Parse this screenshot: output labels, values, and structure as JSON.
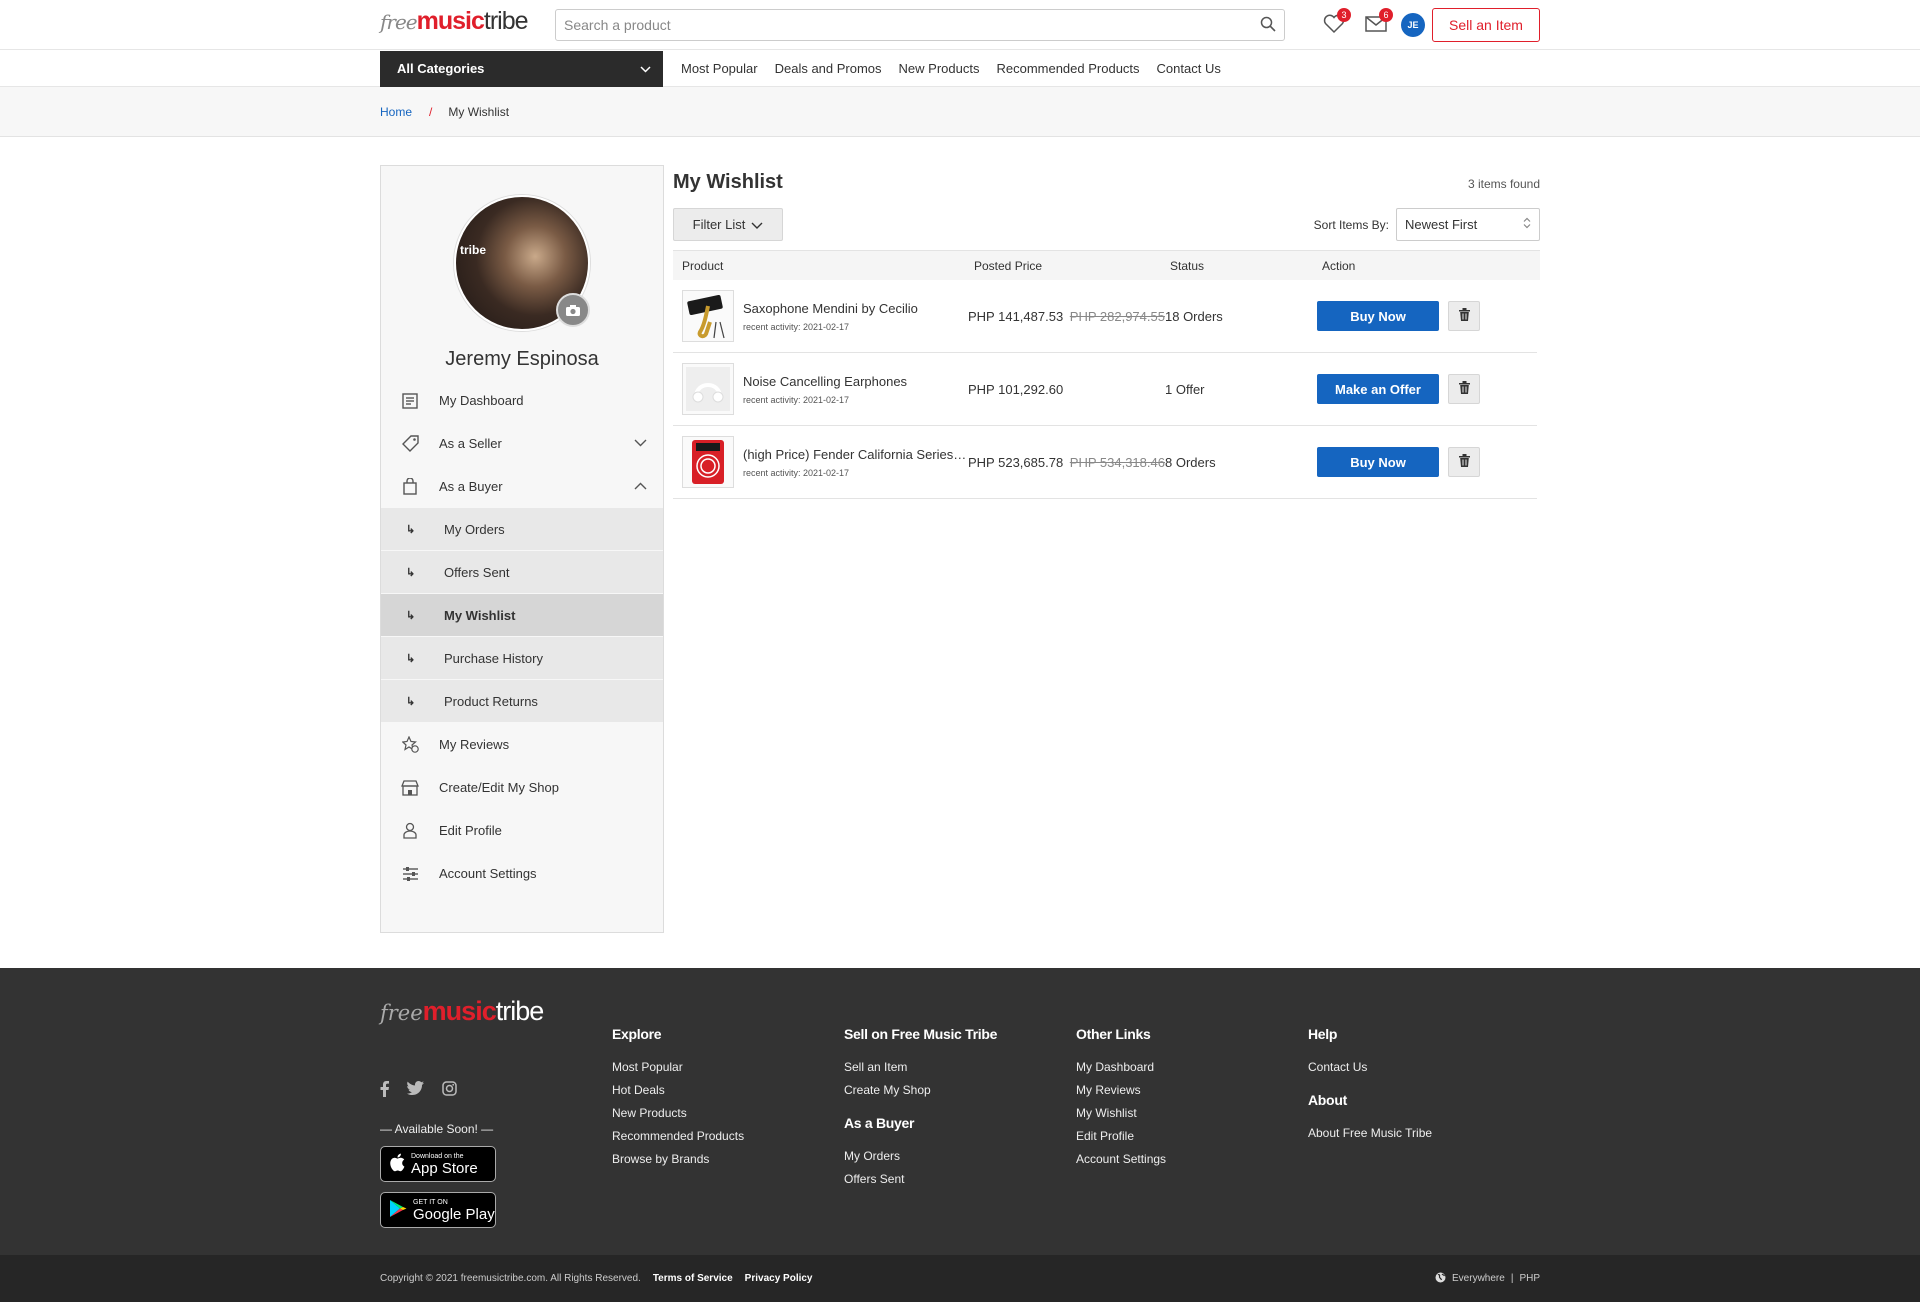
{
  "header": {
    "logo": {
      "free": "free",
      "music": "music",
      "tribe": "tribe"
    },
    "search_placeholder": "Search a product",
    "wishlist_count": "3",
    "messages_count": "6",
    "user_initials": "JE",
    "sell_label": "Sell an Item"
  },
  "nav": {
    "all_categories": "All Categories",
    "links": [
      "Most Popular",
      "Deals and Promos",
      "New Products",
      "Recommended Products",
      "Contact Us"
    ]
  },
  "breadcrumb": {
    "home": "Home",
    "sep": "/",
    "current": "My Wishlist"
  },
  "sidebar": {
    "photo_brand": "tribe",
    "name": "Jeremy Espinosa",
    "items": {
      "dashboard": "My Dashboard",
      "seller": "As a Seller",
      "buyer": "As a Buyer",
      "reviews": "My Reviews",
      "shop": "Create/Edit My Shop",
      "profile": "Edit Profile",
      "settings": "Account Settings"
    },
    "buyer_sub": {
      "arrow": "↳",
      "orders": "My Orders",
      "offers": "Offers Sent",
      "wishlist": "My Wishlist",
      "history": "Purchase History",
      "returns": "Product Returns"
    }
  },
  "content": {
    "title": "My Wishlist",
    "found": "3 items found",
    "filter_label": "Filter List",
    "sort_label": "Sort Items By:",
    "sort_value": "Newest First",
    "columns": {
      "product": "Product",
      "price": "Posted Price",
      "status": "Status",
      "action": "Action"
    },
    "rows": [
      {
        "name": "Saxophone Mendini by Cecilio",
        "activity": "recent activity: 2021-02-17",
        "price": "PHP 141,487.53",
        "old_price": "PHP 282,974.55",
        "status": "18 Orders",
        "action": "Buy Now"
      },
      {
        "name": "Noise Cancelling Earphones",
        "activity": "recent activity: 2021-02-17",
        "price": "PHP 101,292.60",
        "old_price": "",
        "status": "1 Offer",
        "action": "Make an Offer"
      },
      {
        "name": "(high Price) Fender California Series Cable",
        "activity": "recent activity: 2021-02-17",
        "price": "PHP 523,685.78",
        "old_price": "PHP 534,318.46",
        "status": "8 Orders",
        "action": "Buy Now"
      }
    ]
  },
  "footer": {
    "available": "— Available Soon! —",
    "appstore_small": "Download on the",
    "appstore_big": "App Store",
    "googleplay_small": "GET IT ON",
    "googleplay_big": "Google Play",
    "explore": {
      "title": "Explore",
      "links": [
        "Most Popular",
        "Hot Deals",
        "New Products",
        "Recommended Products",
        "Browse by Brands"
      ]
    },
    "sell": {
      "title": "Sell on Free Music Tribe",
      "links": [
        "Sell an Item",
        "Create My Shop"
      ]
    },
    "buyer": {
      "title": "As a Buyer",
      "links": [
        "My Orders",
        "Offers Sent"
      ]
    },
    "other": {
      "title": "Other Links",
      "links": [
        "My Dashboard",
        "My Reviews",
        "My Wishlist",
        "Edit Profile",
        "Account Settings"
      ]
    },
    "help": {
      "title": "Help",
      "links": [
        "Contact Us"
      ]
    },
    "about": {
      "title": "About",
      "links": [
        "About Free Music Tribe"
      ]
    },
    "copyright": "Copyright © 2021 freemusictribe.com. All Rights Reserved.",
    "terms": "Terms of Service",
    "privacy": "Privacy Policy",
    "region": "Everywhere",
    "divider": "|",
    "currency": "PHP"
  },
  "colors": {
    "brand_red": "#e01f2b",
    "action_blue": "#1565c0",
    "footer_bg": "#333333"
  },
  "icons": [
    "search-icon",
    "heart-icon",
    "mail-icon",
    "chevron-down-icon",
    "camera-icon",
    "dashboard-icon",
    "tag-icon",
    "bag-icon",
    "review-icon",
    "shop-icon",
    "profile-icon",
    "settings-icon",
    "trash-icon",
    "facebook-icon",
    "twitter-icon",
    "instagram-icon",
    "apple-icon",
    "google-play-icon",
    "globe-icon"
  ]
}
